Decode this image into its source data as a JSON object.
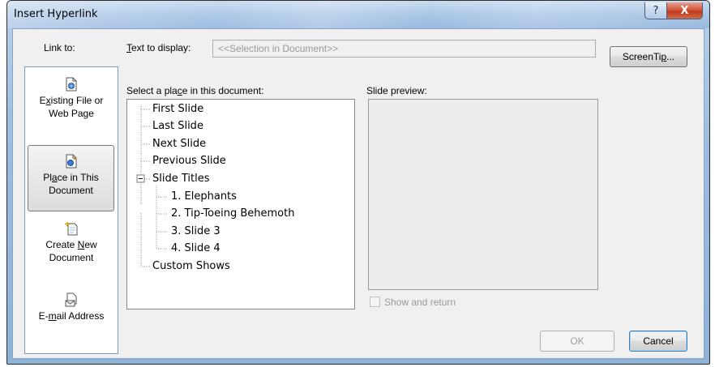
{
  "window": {
    "title": "Insert Hyperlink",
    "help_glyph": "?",
    "close_glyph": "X"
  },
  "link_to": {
    "label": "Link to:",
    "items": [
      {
        "line1_pre": "E",
        "line1_ul": "x",
        "line1_post": "isting File or",
        "line2": "Web Page",
        "icon": "existing-file-icon"
      },
      {
        "line1_pre": "Pl",
        "line1_ul": "a",
        "line1_post": "ce in This",
        "line2": "Document",
        "icon": "place-in-document-icon"
      },
      {
        "line1_pre": "Create ",
        "line1_ul": "N",
        "line1_post": "ew",
        "line2": "Document",
        "icon": "create-new-document-icon"
      },
      {
        "line1_pre": "E-",
        "line1_ul": "m",
        "line1_post": "ail Address",
        "line2": "",
        "icon": "email-icon"
      }
    ]
  },
  "text_to_display": {
    "label_ul": "T",
    "label_rest": "ext to display:",
    "value": "<<Selection in Document>>"
  },
  "screentip": {
    "pre": "ScreenTi",
    "ul": "p",
    "post": "..."
  },
  "place": {
    "label_pre": "Select a pla",
    "label_ul": "c",
    "label_post": "e in this document:",
    "tree": [
      {
        "label": "First Slide"
      },
      {
        "label": "Last Slide"
      },
      {
        "label": "Next Slide"
      },
      {
        "label": "Previous Slide"
      },
      {
        "label": "Slide Titles",
        "expander": "−"
      },
      {
        "label": "1. Elephants"
      },
      {
        "label": "2. Tip-Toeing Behemoth"
      },
      {
        "label": "3. Slide 3"
      },
      {
        "label": "4. Slide 4"
      },
      {
        "label": "Custom Shows"
      }
    ]
  },
  "preview": {
    "label": "Slide preview:",
    "show_and_return": "Show and return"
  },
  "buttons": {
    "ok": "OK",
    "cancel": "Cancel"
  },
  "colors": {
    "title_gradient": "#a9c6e6",
    "close_red": "#c1381a",
    "dialog_bg": "#f0f0f0"
  }
}
